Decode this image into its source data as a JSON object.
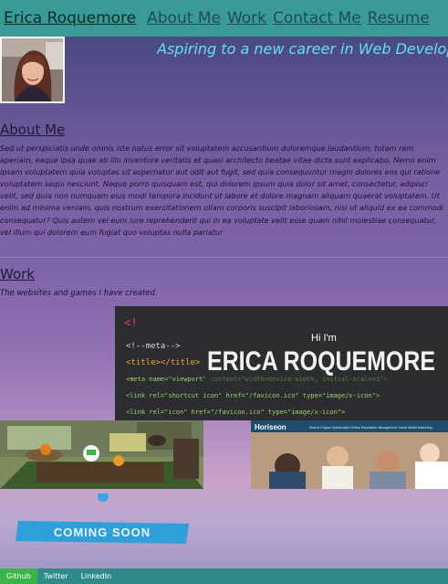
{
  "nav": {
    "brand": "Erica Roquemore",
    "links": [
      "About Me",
      "Work",
      "Contact Me",
      "Resume"
    ],
    "accent_color": "#3a9a96"
  },
  "header": {
    "tagline": "Aspiring to a new career in Web Developing!"
  },
  "about": {
    "title": "About Me",
    "body": "Sed ut perspiciatis unde omnis iste natus error sit voluptatem accusantium doloremque laudantium, totam rem aperiam, eaque ipsa quae ab illo inventore veritatis et quasi architecto beatae vitae dicta sunt explicabo. Nemo enim ipsam voluptatem quia voluptas sit aspernatur aut odit aut fugit, sed quia consequuntur magni dolores eos qui ratione voluptatem sequi nesciunt. Neque porro quisquam est, qui dolorem ipsum quia dolor sit amet, consectetur, adipisci velit, sed quia non numquam eius modi tempora incidunt ut labore et dolore magnam aliquam quaerat voluptatem. Ut enim ad minima veniam, quis nostrum exercitationem ullam corporis suscipit laboriosam, nisi ut aliquid ex ea commodi consequatur? Quis autem vel eum iure reprehenderit qui in ea voluptate velit esse quam nihil molestiae consequatur, vel illum qui dolorem eum fugiat quo voluptas nulla pariatur"
  },
  "work": {
    "title": "Work",
    "subtitle": "The websites and games I have created.",
    "code_banner": {
      "hi": "Hi I'm",
      "name": "ERICA ROQUEMORE",
      "code_lines": [
        "<!--meta-->",
        "<title></title>",
        "<meta name=\"viewport\" content=\"width=device-width, initial-scale=1\">",
        "<link rel=\"shortcut icon\" href=\"/favicon.ico\" type=\"image/x-icon\">",
        "<link rel=\"icon\" href=\"/favicon.ico\" type=\"image/x-icon\">"
      ]
    },
    "horiseon": {
      "brand": "Horiseon",
      "nav": "Search Engine Optimization   Online Reputation Management   Social Media Marketing"
    },
    "coming_soon": "COMING SOON"
  },
  "footer": {
    "links": [
      "Github",
      "Twitter",
      "LinkedIn"
    ],
    "active_color": "#3bb54a"
  }
}
